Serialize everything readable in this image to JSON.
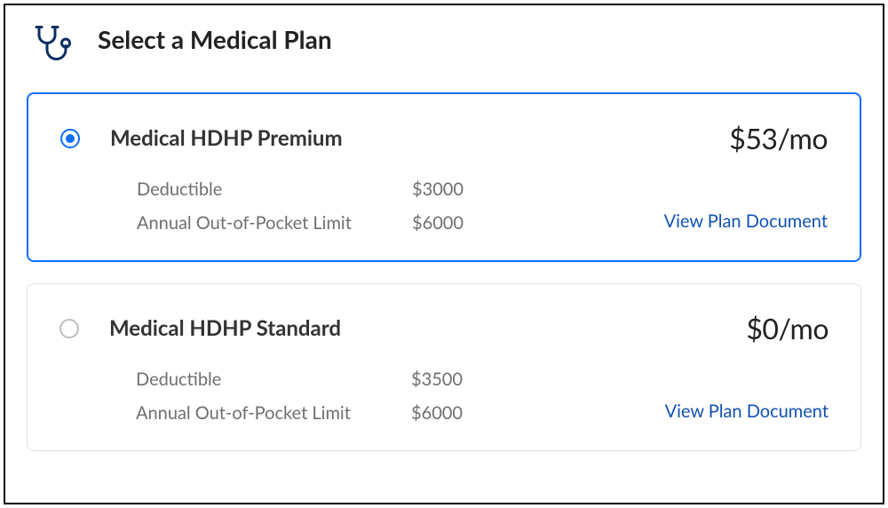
{
  "header": {
    "title": "Select a Medical Plan",
    "icon": "stethoscope-icon"
  },
  "plans": [
    {
      "selected": true,
      "name": "Medical HDHP Premium",
      "price": "$53/mo",
      "details": [
        {
          "label": "Deductible",
          "value": "$3000"
        },
        {
          "label": "Annual Out-of-Pocket Limit",
          "value": "$6000"
        }
      ],
      "link_label": "View Plan Document"
    },
    {
      "selected": false,
      "name": "Medical HDHP Standard",
      "price": "$0/mo",
      "details": [
        {
          "label": "Deductible",
          "value": "$3500"
        },
        {
          "label": "Annual Out-of-Pocket Limit",
          "value": "$6000"
        }
      ],
      "link_label": "View Plan Document"
    }
  ]
}
